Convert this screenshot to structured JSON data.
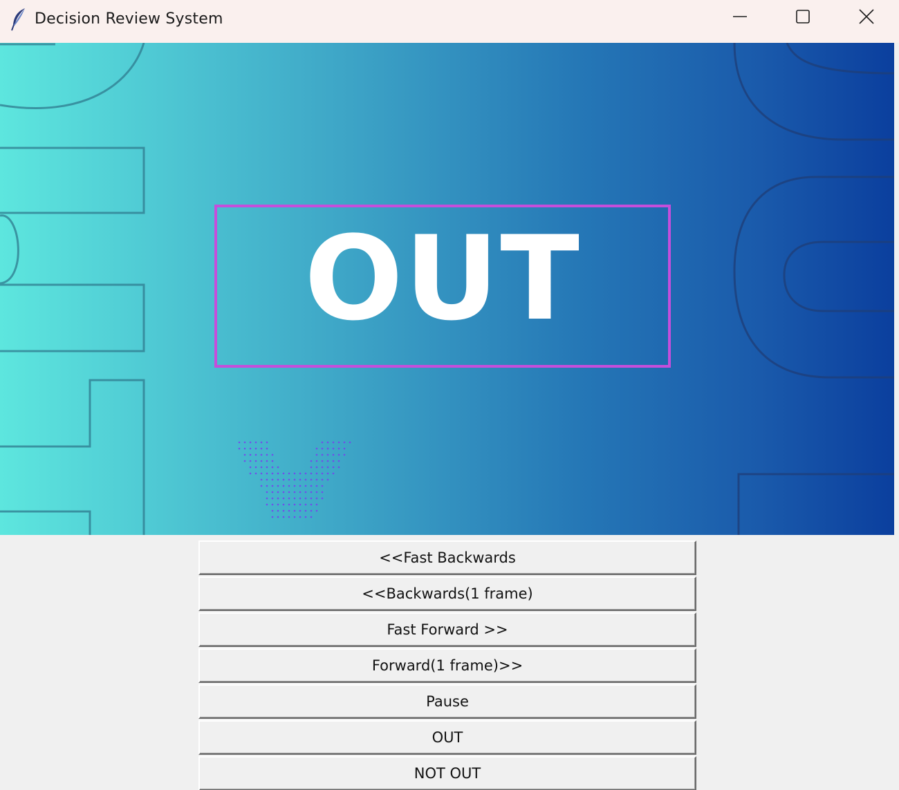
{
  "window": {
    "title": "Decision Review System",
    "app_icon": "feather-icon",
    "controls": {
      "minimize": "minimize-icon",
      "maximize": "maximize-icon",
      "close": "close-icon"
    }
  },
  "video": {
    "decision_text": "OUT",
    "accent_color": "#c54edb",
    "gradient_start": "#5de6de",
    "gradient_end": "#0b3f9e"
  },
  "buttons": [
    {
      "id": "fast-backwards",
      "label": "<<Fast Backwards"
    },
    {
      "id": "backwards-1-frame",
      "label": "<<Backwards(1 frame)"
    },
    {
      "id": "fast-forward",
      "label": "Fast Forward >>"
    },
    {
      "id": "forward-1-frame",
      "label": "Forward(1 frame)>>"
    },
    {
      "id": "pause",
      "label": "Pause"
    },
    {
      "id": "out",
      "label": "OUT"
    },
    {
      "id": "not-out",
      "label": "NOT OUT"
    }
  ]
}
